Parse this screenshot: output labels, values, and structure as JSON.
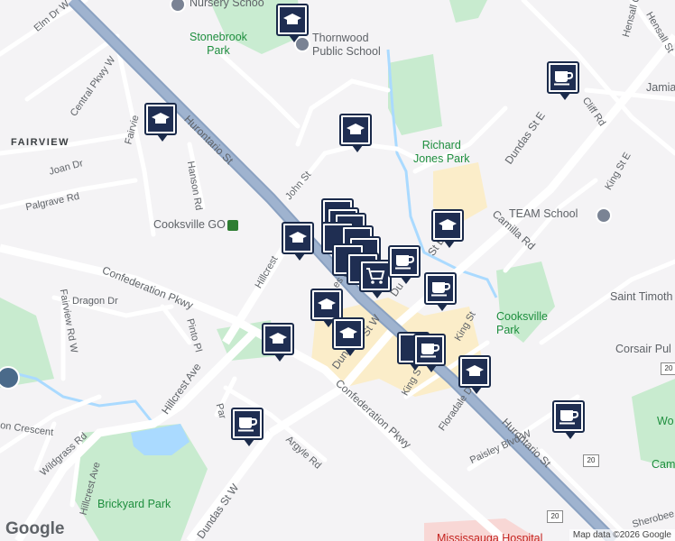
{
  "map": {
    "areas": {
      "fairview": "FAIRVIEW"
    },
    "streets": {
      "elm_dr_w": "Elm Dr W",
      "central_pkwy_w": "Central Pkwy W",
      "hurontario_st_north": "Hurontario St",
      "hurontario_st_south": "Hurontario St",
      "joan_dr": "Joan Dr",
      "fairview_top": "Fairvie",
      "hanson_rd": "Hanson Rd",
      "palgrave_rd": "Palgrave Rd",
      "john_st": "John St",
      "hillcrest_top": "Hillcrest",
      "confederation_pkwy_w": "Confederation Pkwy",
      "confederation_pkwy_e": "Confederation Pkwy",
      "dragon_dr": "Dragon Dr",
      "fairview_rd_w": "Fairview Rd W",
      "pinto_pl": "Pinto Pl",
      "hillcrest_ave": "Hillcrest Ave",
      "hillcrest_ave_sw": "Hillcrest Ave",
      "on_crescent": "on Crescent",
      "wildgrass_rd": "Wildgrass Rd",
      "park_st_w": "Par",
      "argyle_rd": "Argyle Rd",
      "dundas_st_w_south": "Dundas St W",
      "dundas_st_w_mid": "Dun",
      "dundas_st_w_label": "St W",
      "dundas_st_e_north": "Dundas St E",
      "dundas_st_e_mid": "St E",
      "dundas_st_e_mid2": "Du",
      "cliff_rd": "Cliff Rd",
      "king_st_e": "King St E",
      "camilla_rd": "Camilla Rd",
      "king_st": "King St",
      "king_s": "King S",
      "floradale_dr": "Floradale Dr",
      "paisley_blvd_w": "Paisley Blvd W",
      "hensall_st": "Hensall St",
      "hensall_c": "Hensall C",
      "sherobee": "Sherobee",
      "es_st": "es St",
      "route_20a": "20",
      "route_20b": "20",
      "route_20c": "20"
    },
    "places": {
      "nursery": "Nursery Schoo",
      "stonebrook": "Stonebrook\nPark",
      "thornwood": "Thornwood\nPublic School",
      "richard_jones": "Richard\nJones Park",
      "team_school": "TEAM School",
      "cooksville_go": "Cooksville GO",
      "saint_timothy": "Saint Timoth",
      "cooksville_park": "Cooksville\nPark",
      "corsair": "Corsair Pul",
      "jamia": "Jamia",
      "brickyard": "Brickyard Park",
      "wo": "Wo",
      "cam": "Cam",
      "mississauga_hospital": "Mississauga Hospital"
    },
    "attribution": "Map data ©2026 Google",
    "logo": "Google"
  },
  "markers": [
    {
      "type": "school",
      "name": "school-marker-1"
    },
    {
      "type": "school",
      "name": "school-marker-2"
    },
    {
      "type": "school",
      "name": "school-marker-3"
    },
    {
      "type": "school",
      "name": "school-marker-4"
    },
    {
      "type": "school",
      "name": "school-marker-5"
    },
    {
      "type": "school",
      "name": "school-marker-6"
    },
    {
      "type": "school",
      "name": "school-marker-7"
    },
    {
      "type": "school",
      "name": "school-marker-8"
    },
    {
      "type": "cafe",
      "name": "cafe-marker-1"
    },
    {
      "type": "cafe",
      "name": "cafe-marker-2"
    },
    {
      "type": "cafe",
      "name": "cafe-marker-3"
    },
    {
      "type": "cafe",
      "name": "cafe-marker-4"
    },
    {
      "type": "cafe",
      "name": "cafe-marker-5"
    },
    {
      "type": "cafe",
      "name": "cafe-marker-6"
    },
    {
      "type": "grocery",
      "name": "grocery-marker-1"
    }
  ]
}
